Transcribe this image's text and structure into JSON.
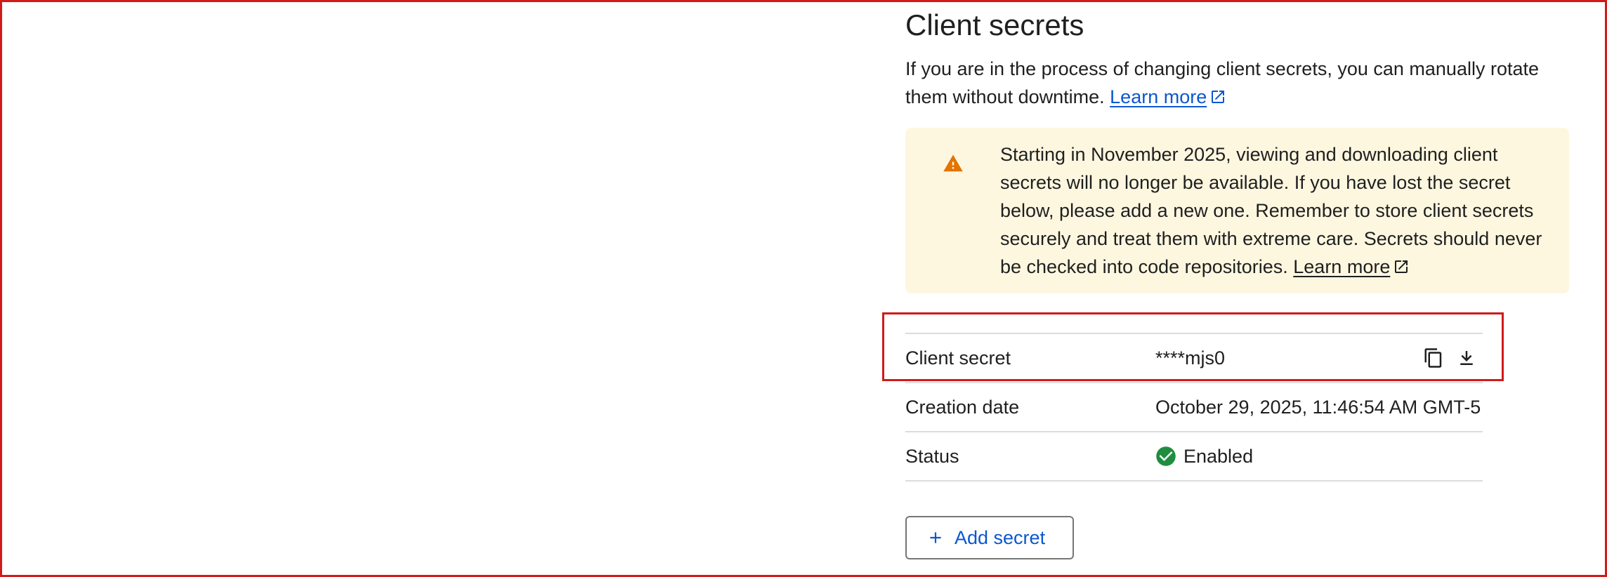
{
  "section": {
    "title": "Client secrets",
    "description": "If you are in the process of changing client secrets, you can manually rotate them without downtime.",
    "learn_more": "Learn more"
  },
  "warning": {
    "text": "Starting in November 2025, viewing and downloading client secrets will no longer be available. If you have lost the secret below, please add a new one. Remember to store client secrets securely and treat them with extreme care. Secrets should never be checked into code repositories.",
    "learn_more": "Learn more",
    "icon": "warning-triangle-icon",
    "bg_color": "#fef7e0",
    "icon_color": "#e37400"
  },
  "details": {
    "client_secret_label": "Client secret",
    "client_secret_value": "****mjs0",
    "creation_date_label": "Creation date",
    "creation_date_value": "October 29, 2025, 11:46:54 AM GMT-5",
    "status_label": "Status",
    "status_value": "Enabled",
    "status_color": "#1e8e3e"
  },
  "actions": {
    "add_secret": "Add secret",
    "copy_icon": "copy-icon",
    "download_icon": "download-icon"
  },
  "colors": {
    "link": "#0b57d0",
    "highlight": "#d11a1a"
  }
}
